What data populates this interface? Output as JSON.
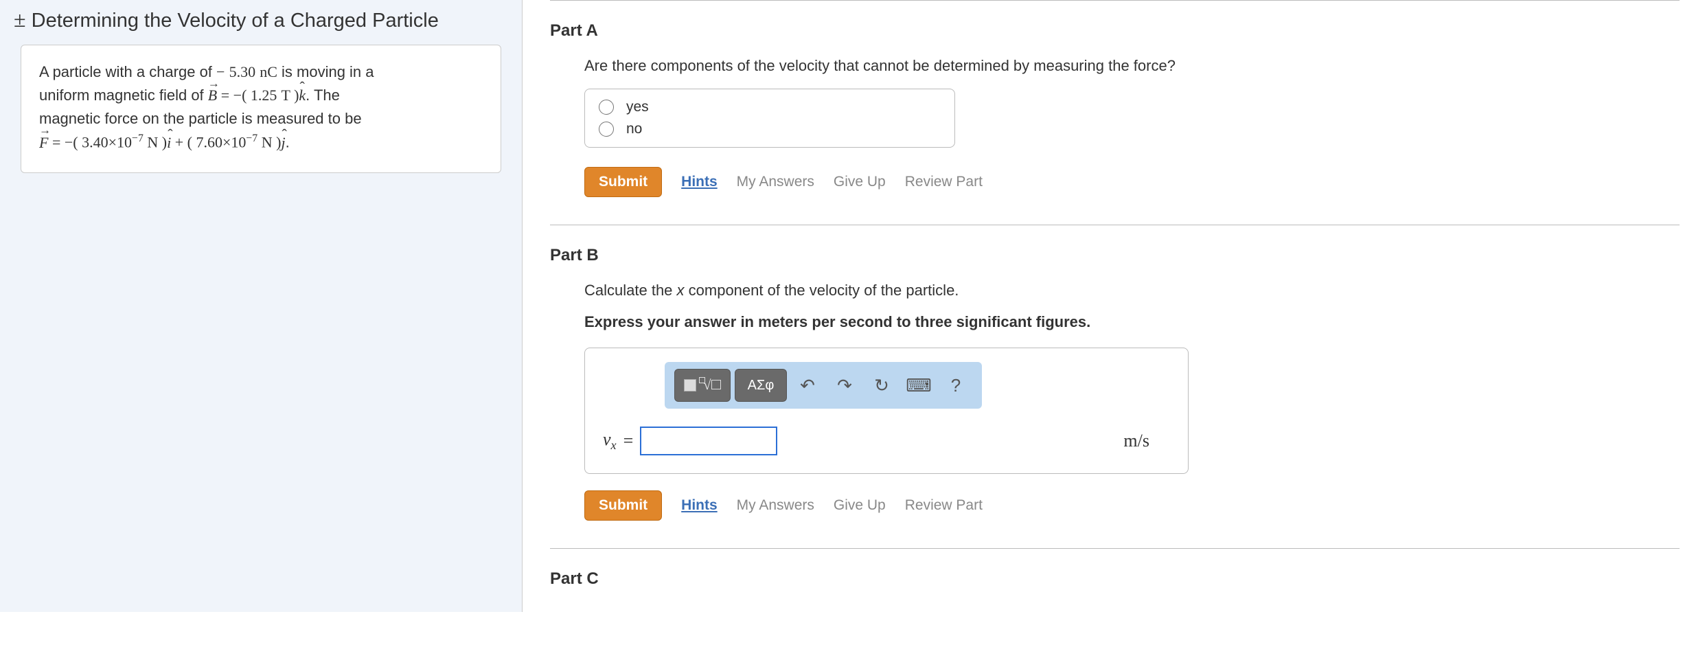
{
  "title_prefix": "±",
  "title": "Determining the Velocity of a Charged Particle",
  "problem": {
    "line1_a": "A particle with a charge of ",
    "charge_sign": "−",
    "charge_val": "5.30",
    "charge_unit": "nC",
    "line1_b": " is moving in a",
    "line2_a": "uniform magnetic field of ",
    "B_label": "B",
    "eq": " = ",
    "B_sign": "−( ",
    "B_val": "1.25",
    "B_unit": "T",
    "B_close": " )",
    "B_hat": "k",
    "line2_b": ". The",
    "line3_a": "magnetic force on the particle is measured to be",
    "F_label": "F",
    "F1_sign": "−( ",
    "F1_val": "3.40×10",
    "F1_exp": "−7",
    "F1_unit": " N",
    "F1_close": " )",
    "F1_hat": "i",
    "plus": " + ( ",
    "F2_val": "7.60×10",
    "F2_exp": "−7",
    "F2_unit": " N",
    "F2_close": " )",
    "F2_hat": "j",
    "period": "."
  },
  "partA": {
    "heading": "Part A",
    "prompt": "Are there components of the velocity that cannot be determined by measuring the force?",
    "opt_yes": "yes",
    "opt_no": "no"
  },
  "partB": {
    "heading": "Part B",
    "prompt": "Calculate the x component of the velocity of the particle.",
    "subprompt": "Express your answer in meters per second to three significant figures.",
    "var": "v",
    "varsub": "x",
    "equals": "=",
    "units": "m/s",
    "input_value": ""
  },
  "partC": {
    "heading": "Part C"
  },
  "toolbar": {
    "greek": "ΑΣφ",
    "help": "?"
  },
  "actions": {
    "submit": "Submit",
    "hints": "Hints",
    "my_answers": "My Answers",
    "give_up": "Give Up",
    "review": "Review Part"
  }
}
